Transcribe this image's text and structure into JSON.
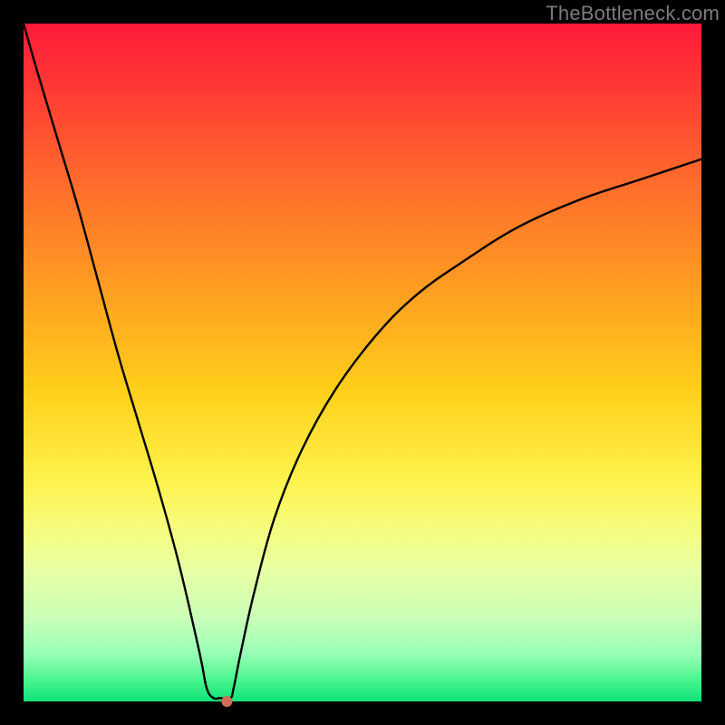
{
  "watermark": "TheBottleneck.com",
  "chart_data": {
    "type": "line",
    "title": "",
    "xlabel": "",
    "ylabel": "",
    "xlim": [
      0,
      100
    ],
    "ylim": [
      0,
      100
    ],
    "grid": false,
    "axes_visible": false,
    "background_gradient": {
      "direction": "vertical",
      "stops": [
        {
          "pos": 0.0,
          "color": "#ff1a3a"
        },
        {
          "pos": 0.54,
          "color": "#ffcf1a"
        },
        {
          "pos": 0.81,
          "color": "#e6ffa6"
        },
        {
          "pos": 1.0,
          "color": "#0ee27a"
        }
      ]
    },
    "series": [
      {
        "name": "bottleneck-curve",
        "x": [
          0,
          2,
          5,
          8,
          11,
          14,
          17,
          20,
          23,
          26,
          27,
          28,
          29,
          30.5,
          31,
          32,
          34,
          37,
          41,
          46,
          52,
          58,
          65,
          73,
          82,
          91,
          100
        ],
        "y": [
          100,
          93,
          83,
          73,
          62,
          51,
          41,
          31,
          20,
          7,
          2,
          0.5,
          0.5,
          0.5,
          2,
          7,
          16,
          27,
          37,
          46,
          54,
          60,
          65,
          70,
          74,
          77,
          80
        ]
      }
    ],
    "markers": [
      {
        "name": "vertex-point",
        "x": 30,
        "y": 0,
        "color": "#d06d57",
        "radius_px": 6
      }
    ]
  }
}
